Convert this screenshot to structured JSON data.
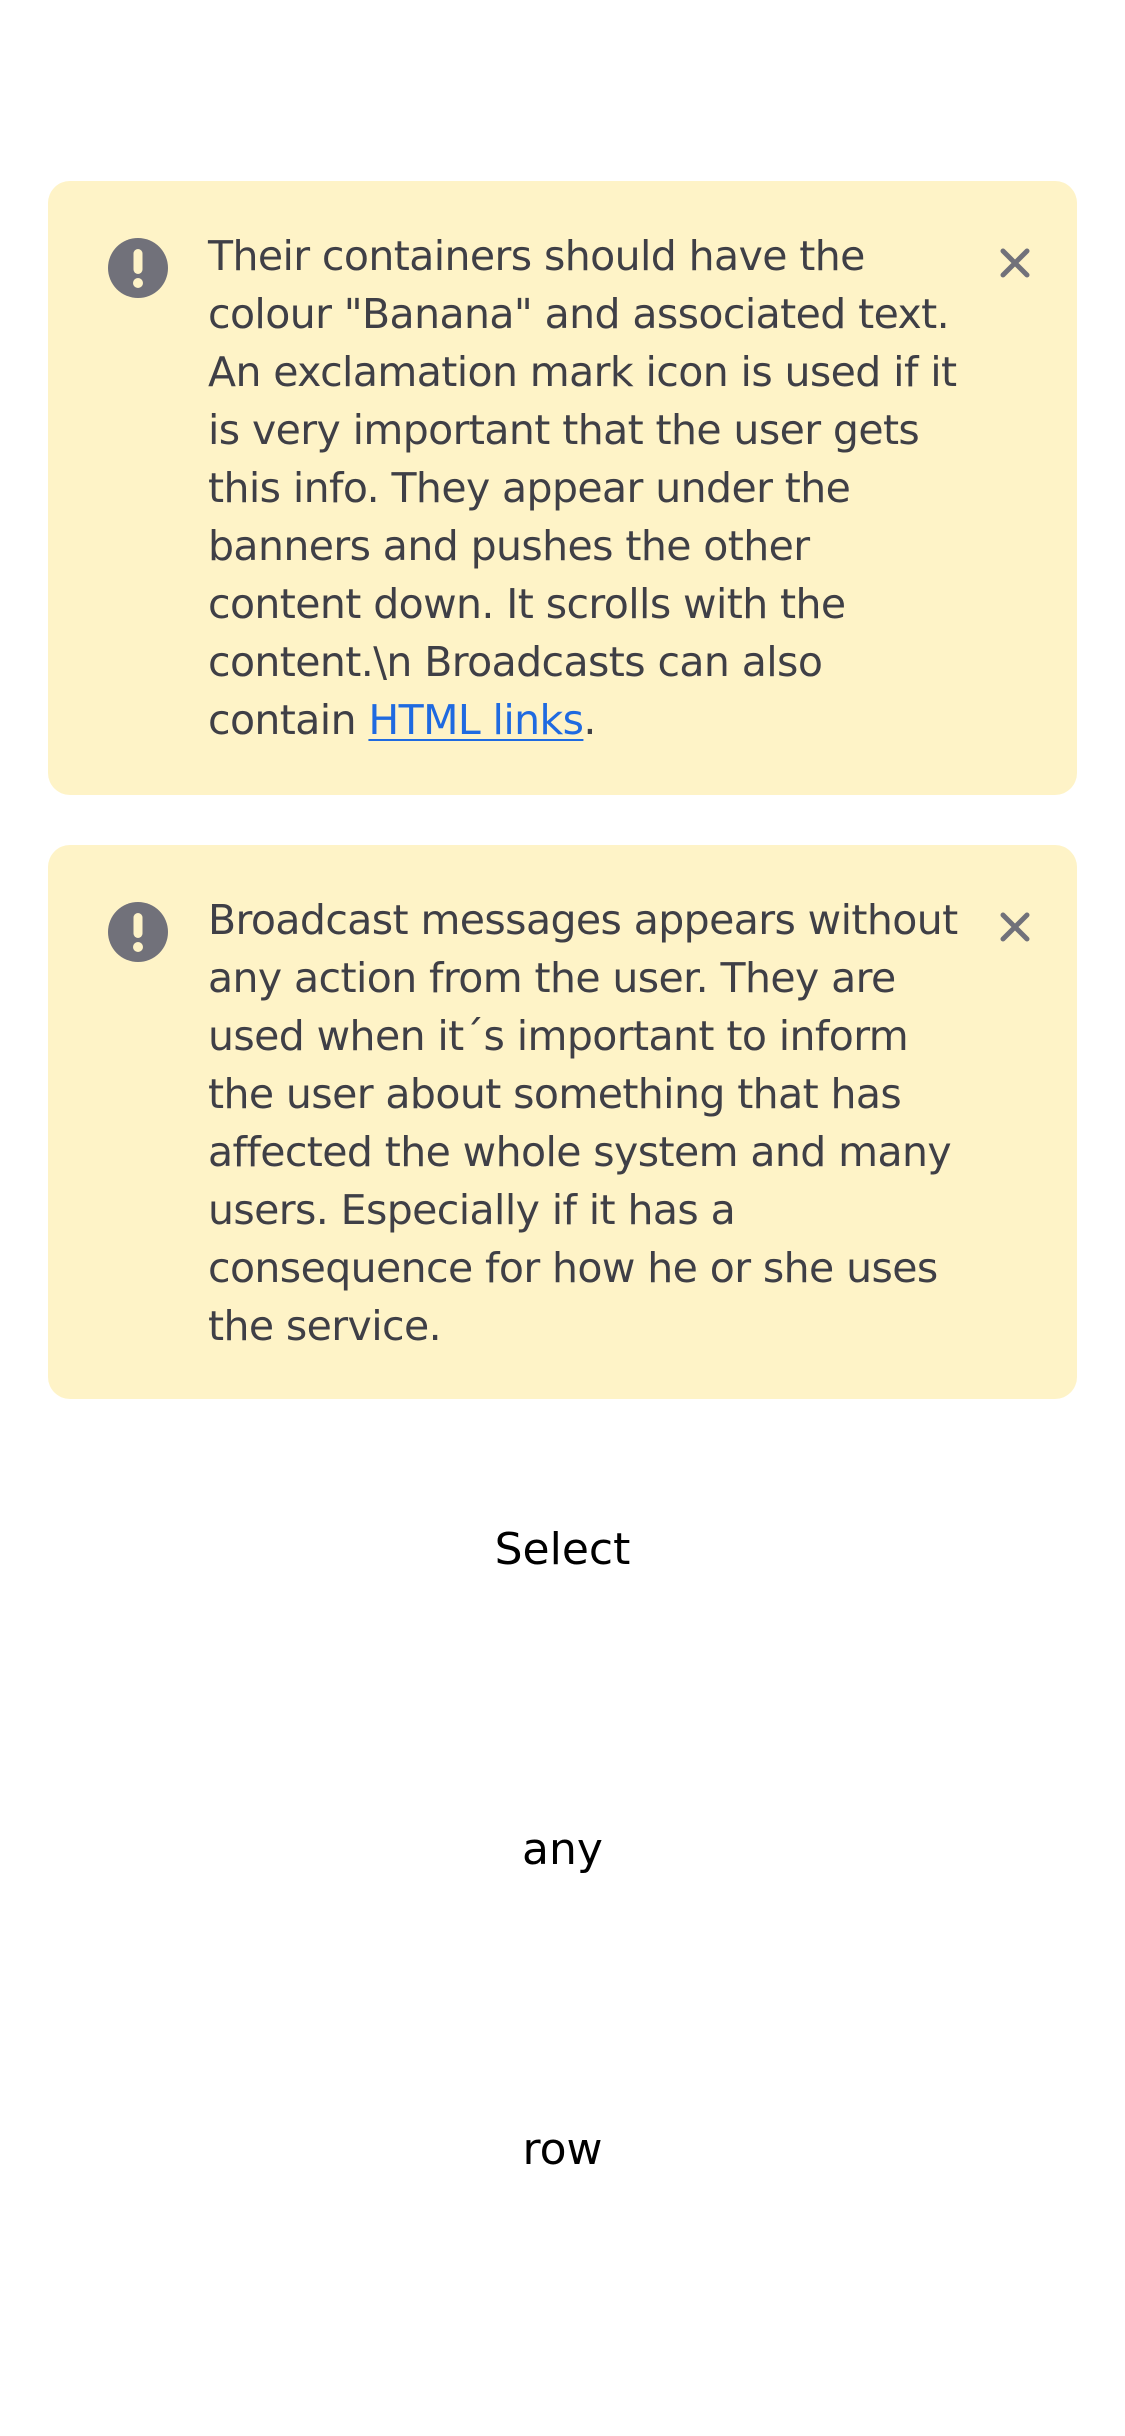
{
  "broadcasts": [
    {
      "text_before_link": "Their containers should have the colour \"Banana\" and associated text. An exclamation mark icon is used if it is very important that the user gets this info. They appear under the banners and pushes the other content down. It scrolls with the content.\\n Broadcasts can also contain ",
      "link_text": "HTML links",
      "text_after_link": ".",
      "icon": "exclamation-circle-icon",
      "close_icon": "close-icon"
    },
    {
      "text": "Broadcast messages appears without any action from the user. They are used when it´s important to inform the user about something that has affected the whole system and many users. Especially if it has a consequence for how he or she uses the service.",
      "icon": "exclamation-circle-icon",
      "close_icon": "close-icon"
    }
  ],
  "select": {
    "title": "Select",
    "options": [
      "any",
      "row"
    ]
  },
  "colors": {
    "broadcast_background": "#fef3c7",
    "broadcast_text": "#3f3f46",
    "icon_gray": "#71717a",
    "link": "#1f6ae0"
  }
}
